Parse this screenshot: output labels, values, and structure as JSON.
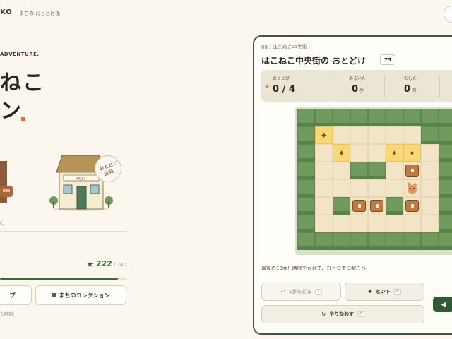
{
  "header": {
    "logo": "KO",
    "subtitle": "まちの おとどけ係"
  },
  "hero": {
    "eyebrow": "ADVENTURE.",
    "line1": "ねこ",
    "line2": "ン",
    "small_label": "C."
  },
  "stamp": {
    "line1": "おとどけ",
    "line2": "日和"
  },
  "house": {
    "sign": "POST"
  },
  "score": {
    "value": "222",
    "max": "/ 240",
    "progress_percent": 92.5
  },
  "left_buttons": {
    "first": "プ",
    "collection": "まちのコレクション"
  },
  "footnote": "た時刻。",
  "game": {
    "level_tag": "08 / はこねこ中央街",
    "title": "はこねこ中央街の おとどけ",
    "badge": "75",
    "stats": [
      {
        "label": "おとどけ",
        "value": "0 / 4",
        "unit": ""
      },
      {
        "label": "あるいた",
        "value": "0",
        "unit": "歩"
      },
      {
        "label": "おした",
        "value": "0",
        "unit": "回"
      }
    ],
    "board": [
      "WWWWWWWWW",
      "WGFFFFFWW",
      "WFGFFGGFW",
      "WFFWWFBFW",
      "WFFFFFPFW",
      "WFWBBWBFW",
      "WFFFFFFFW",
      "WWWWWWWWW"
    ],
    "hint_text": "最後の10面！時間をかけて、ひとつずつ解こう。",
    "buttons": {
      "undo": "1歩もどる",
      "undo_key": "Z",
      "hint": "ヒント",
      "hint_key": "H",
      "reset": "やりなおす",
      "reset_key": "R"
    }
  },
  "colors": {
    "accent": "#2f5a34",
    "wall": "#6f9a5c",
    "floor": "#f2e4c6",
    "goal": "#f7d776",
    "crate": "#c07a40"
  }
}
